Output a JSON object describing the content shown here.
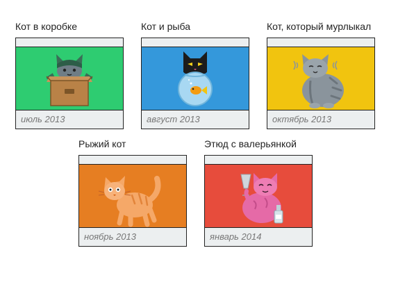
{
  "cards": [
    {
      "title": "Кот в коробке",
      "date": "июль 2013",
      "bg_color": "#2ecc71",
      "icon": "cat-in-box-icon"
    },
    {
      "title": "Кот и рыба",
      "date": "август 2013",
      "bg_color": "#3498db",
      "icon": "cat-and-fish-icon"
    },
    {
      "title": "Кот, который мурлыкал",
      "date": "октябрь 2013",
      "bg_color": "#f1c40f",
      "icon": "purring-cat-icon"
    },
    {
      "title": "Рыжий кот",
      "date": "ноябрь 2013",
      "bg_color": "#e67e22",
      "icon": "ginger-cat-icon"
    },
    {
      "title": "Этюд с валерьянкой",
      "date": "январь 2014",
      "bg_color": "#e74c3c",
      "icon": "cat-with-valerian-icon"
    }
  ]
}
